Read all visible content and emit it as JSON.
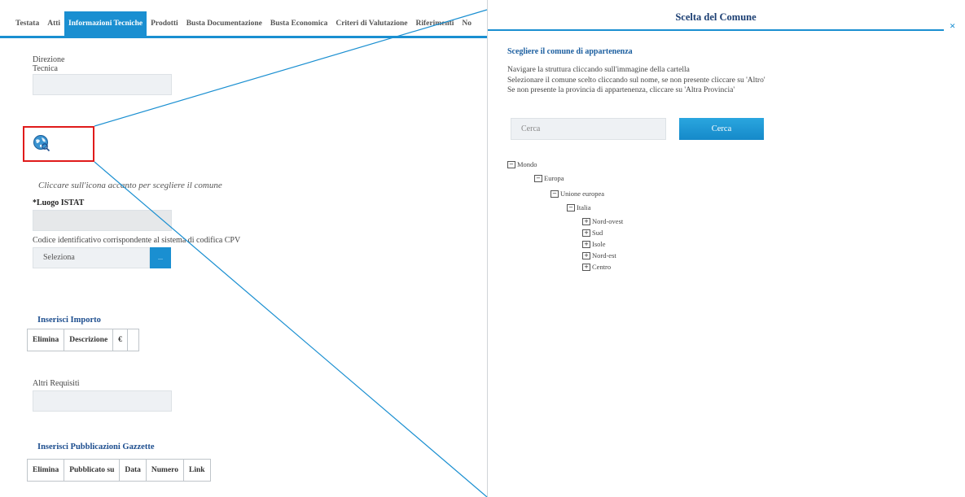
{
  "tabs": [
    "Testata",
    "Atti",
    "Informazioni Tecniche",
    "Prodotti",
    "Busta Documentazione",
    "Busta Economica",
    "Criteri di Valutazione",
    "Riferimenti",
    "No"
  ],
  "active_tab": "Informazioni Tecniche",
  "form": {
    "direzione_label_1": "Direzione",
    "direzione_label_2": "Tecnica",
    "hint": "Cliccare sull'icona accanto per scegliere il comune",
    "luogo_label": "*Luogo ISTAT",
    "cpv_label": "Codice identificativo corrispondente al sistema di codifica CPV",
    "cpv_select": "Seleziona",
    "cpv_button": "...",
    "importo_title": "Inserisci Importo",
    "importo_cols": [
      "Elimina",
      "Descrizione",
      "€",
      ""
    ],
    "altri_label": "Altri Requisiti",
    "gazzette_title": "Inserisci Pubblicazioni Gazzette",
    "gazzette_cols": [
      "Elimina",
      "Pubblicato su",
      "Data",
      "Numero",
      "Link"
    ]
  },
  "dialog": {
    "title": "Scelta del Comune",
    "close": "×",
    "subtitle": "Scegliere il comune di appartenenza",
    "instructions": [
      "Navigare la struttura cliccando sull'immagine della cartella",
      "Selezionare il comune scelto cliccando sul nome, se non presente cliccare su 'Altro'",
      "Se non presente la provincia di appartenenza, cliccare su 'Altra Provincia'"
    ],
    "search_placeholder": "Cerca",
    "search_button": "Cerca",
    "tree": [
      {
        "label": "Mondo",
        "state": "expanded"
      },
      {
        "label": "Europa",
        "state": "expanded"
      },
      {
        "label": "Unione europea",
        "state": "expanded"
      },
      {
        "label": "Italia",
        "state": "expanded"
      },
      {
        "label": "Nord-ovest",
        "state": "collapsed"
      },
      {
        "label": "Sud",
        "state": "collapsed"
      },
      {
        "label": "Isole",
        "state": "collapsed"
      },
      {
        "label": "Nord-est",
        "state": "collapsed"
      },
      {
        "label": "Centro",
        "state": "collapsed"
      }
    ]
  },
  "colors": {
    "accent": "#1a8fd1",
    "highlight": "#e01b1b",
    "title": "#1c3f73"
  }
}
